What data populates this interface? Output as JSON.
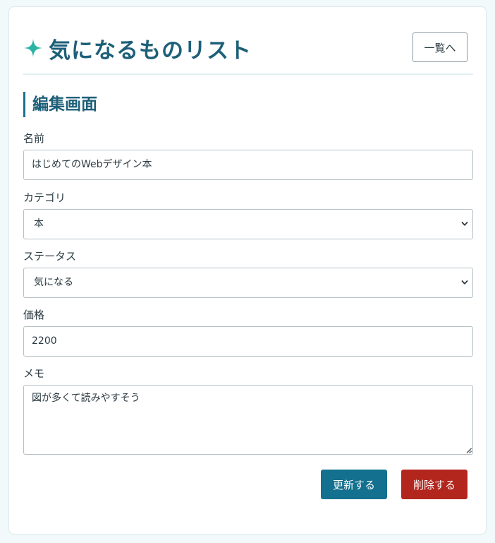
{
  "app": {
    "title": "気になるものリスト",
    "back_button": "一覧へ"
  },
  "section": {
    "title": "編集画面"
  },
  "form": {
    "name": {
      "label": "名前",
      "value": "はじめてのWebデザイン本"
    },
    "category": {
      "label": "カテゴリ",
      "value": "本"
    },
    "status": {
      "label": "ステータス",
      "value": "気になる"
    },
    "price": {
      "label": "価格",
      "value": "2200"
    },
    "memo": {
      "label": "メモ",
      "value": "図が多くて読みやすそう"
    }
  },
  "actions": {
    "update_label": "更新する",
    "delete_label": "削除する"
  },
  "icons": {
    "title_icon": "sparkle-icon",
    "select_icon": "chevron-down-icon",
    "resize_icon": "resize-grip-icon"
  },
  "colors": {
    "accent": "#1d5f78",
    "sparkle": "#2bb3a3",
    "primary_button": "#13708e",
    "danger_button": "#b3261e",
    "page_background": "#f1f9fb"
  }
}
